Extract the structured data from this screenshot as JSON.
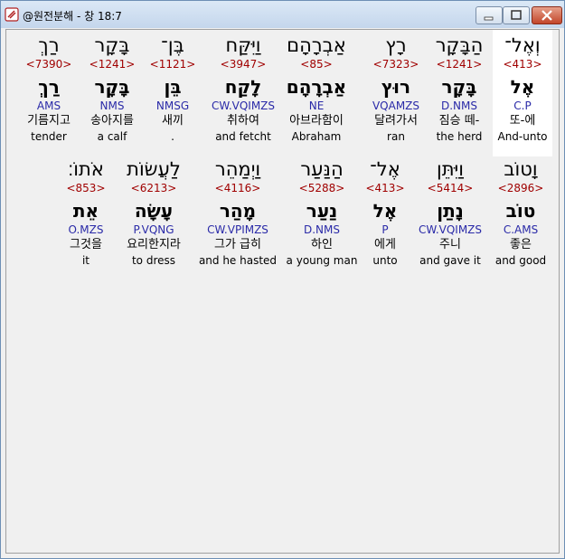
{
  "window": {
    "title": "@원전분해 - 창 18:7"
  },
  "colors": {
    "strong": "#a00000",
    "morph": "#2a2aa8",
    "titlebar": "#c4d6ec"
  },
  "row1": [
    {
      "heb": "וְאֶל־",
      "strong": "<413>",
      "lemma": "אֶל",
      "morph": "C.P",
      "kor": "또-에",
      "eng": "And-unto",
      "sel": true
    },
    {
      "heb": "הַבָּקָר",
      "strong": "<1241>",
      "lemma": "בָּקָר",
      "morph": "D.NMS",
      "kor": "짐승 떼-",
      "eng": "the herd"
    },
    {
      "heb": "רָץ",
      "strong": "<7323>",
      "lemma": "רוּץ",
      "morph": "VQAMZS",
      "kor": "달려가서",
      "eng": "ran"
    },
    {
      "heb": "אַבְרָהָם",
      "strong": "<85>",
      "lemma": "אַבְרָהָם",
      "morph": "NE",
      "kor": "아브라함이",
      "eng": "Abraham"
    },
    {
      "heb": "וַיִּקַּח",
      "strong": "<3947>",
      "lemma": "לָקַח",
      "morph": "CW.VQIMZS",
      "kor": "취하여",
      "eng": "and fetcht"
    },
    {
      "heb": "בֶּן־",
      "strong": "<1121>",
      "lemma": "בֵּן",
      "morph": "NMSG",
      "kor": "새끼",
      "eng": "."
    },
    {
      "heb": "בָּקָר",
      "strong": "<1241>",
      "lemma": "בָּקָר",
      "morph": "NMS",
      "kor": "송아지를",
      "eng": "a calf"
    },
    {
      "heb": "רַךְ",
      "strong": "<7390>",
      "lemma": "רַךְ",
      "morph": "AMS",
      "kor": "기름지고",
      "eng": "tender"
    }
  ],
  "row2": [
    {
      "heb": "וָטוֹב",
      "strong": "<2896>",
      "lemma": "טוֹב",
      "morph": "C.AMS",
      "kor": "좋은",
      "eng": "and good"
    },
    {
      "heb": "וַיִּתֵּן",
      "strong": "<5414>",
      "lemma": "נָתַן",
      "morph": "CW.VQIMZS",
      "kor": "주니",
      "eng": "and gave it"
    },
    {
      "heb": "אֶל־",
      "strong": "<413>",
      "lemma": "אֶל",
      "morph": "P",
      "kor": "에게",
      "eng": "unto"
    },
    {
      "heb": "הַנַּעַר",
      "strong": "<5288>",
      "lemma": "נַעַר",
      "morph": "D.NMS",
      "kor": "하인",
      "eng": "a young man"
    },
    {
      "heb": "וַיְמַהֵר",
      "strong": "<4116>",
      "lemma": "מָהַר",
      "morph": "CW.VPIMZS",
      "kor": "그가 급히",
      "eng": "and he hasted"
    },
    {
      "heb": "לַעֲשׂוֹת",
      "strong": "<6213>",
      "lemma": "עָשָׂה",
      "morph": "P.VQNG",
      "kor": "요리한지라",
      "eng": "to dress"
    },
    {
      "heb": "אֹתוֹ׃",
      "strong": "<853>",
      "lemma": "אֵת",
      "morph": "O.MZS",
      "kor": "그것을",
      "eng": "it"
    }
  ]
}
